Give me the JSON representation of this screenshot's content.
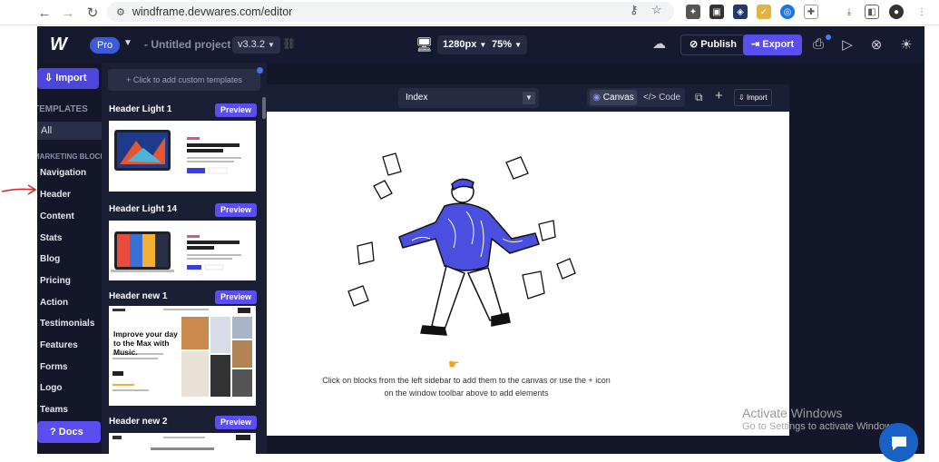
{
  "browser": {
    "url": "windframe.devwares.com/editor",
    "back": "←",
    "forward": "→",
    "reload": "↻"
  },
  "topbar": {
    "logo": "W",
    "badge": "Pro",
    "project_title": "- Untitled project",
    "version": "v3.3.2",
    "screen_size": "1280px",
    "zoom": "75%",
    "publish_label": "Publish",
    "export_label": "Export"
  },
  "sidebar": {
    "import_label": "Import",
    "templates_heading": "TEMPLATES",
    "all_label": "All",
    "marketing_heading": "MARKETING BLOCKS",
    "categories": [
      "Navigation",
      "Header",
      "Content",
      "Stats",
      "Blog",
      "Pricing",
      "Action",
      "Testimonials",
      "Features",
      "Forms",
      "Logo",
      "Teams"
    ],
    "docs_label": "Docs"
  },
  "templates": {
    "add_label": "+ Click to add custom templates",
    "items": [
      {
        "name": "Header Light 1",
        "preview": "Preview",
        "thumb_text": "Write anything and start being creative"
      },
      {
        "name": "Header Light 14",
        "preview": "Preview",
        "thumb_text": "Write anything and start being creative"
      },
      {
        "name": "Header new 1",
        "preview": "Preview",
        "thumb_text": "Improve your day to the Max with Music."
      },
      {
        "name": "Header new 2",
        "preview": "Preview",
        "thumb_text": ""
      }
    ]
  },
  "window": {
    "page_select": "Index",
    "canvas_tab": "Canvas",
    "code_tab": "</> Code",
    "import_label": "Import"
  },
  "canvas": {
    "hint": "Click on blocks from the left sidebar to add them to the canvas or use the + icon on the window toolbar above to add elements"
  },
  "os": {
    "watermark_title": "Activate Windows",
    "watermark_sub": "Go to Settings to activate Windows."
  },
  "colors": {
    "app_bg": "#14172a",
    "accent": "#5b4ef0",
    "pro_badge": "#3b5bdb",
    "illustration_blue": "#4a4fe0"
  }
}
